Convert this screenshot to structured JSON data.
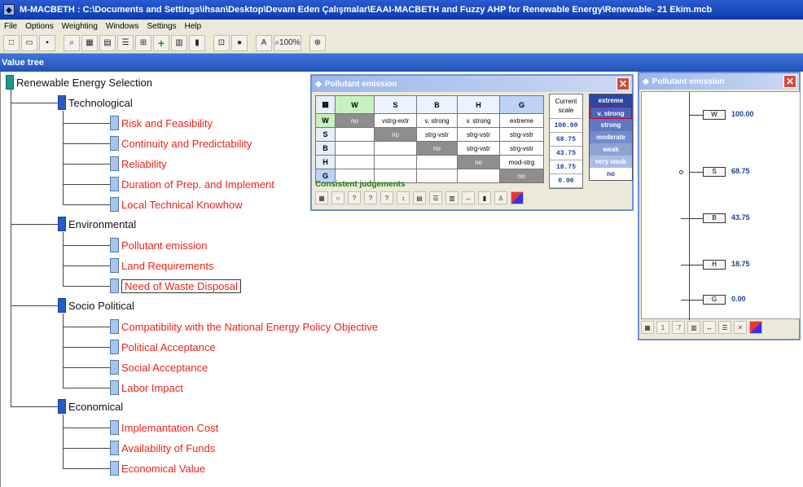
{
  "window": {
    "title": "M-MACBETH : C:\\Documents and Settings\\ihsan\\Desktop\\Devam Eden Çalışmalar\\EAAI-MACBETH and Fuzzy AHP for Renewable Energy\\Renewable- 21 Ekim.mcb"
  },
  "menu": [
    "File",
    "Options",
    "Weighting",
    "Windows",
    "Settings",
    "Help"
  ],
  "toolbar": {
    "zoom": "100%"
  },
  "panel": {
    "title": "Value tree"
  },
  "tree": {
    "root": "Renewable Energy Selection",
    "groups": [
      {
        "label": "Technological",
        "items": [
          "Risk and Feasibility",
          "Continuity and Predictability",
          "Reliability",
          "Duration of Prep. and Implement",
          "Local Technical Knowhow"
        ]
      },
      {
        "label": "Environmental",
        "items": [
          "Pollutant emission",
          "Land Requirements",
          "Need of Waste Disposal"
        ]
      },
      {
        "label": "Socio Political",
        "items": [
          "Compatibility with the National Energy Policy Objective",
          "Political Acceptance",
          "Social Acceptance",
          "Labor Impact"
        ]
      },
      {
        "label": "Economical",
        "items": [
          "Implemantation Cost",
          "Availability of Funds",
          "Economical Value"
        ]
      }
    ]
  },
  "matrix": {
    "title": "Pollutant emission",
    "columns": [
      "W",
      "S",
      "B",
      "H",
      "G"
    ],
    "rows": [
      {
        "h": "W",
        "cells": [
          "no",
          "vstrg-extr",
          "v. strong",
          "v. strong",
          "extreme"
        ]
      },
      {
        "h": "S",
        "cells": [
          "",
          "no",
          "strg-vstr",
          "strg-vstr",
          "strg-vstr"
        ]
      },
      {
        "h": "B",
        "cells": [
          "",
          "",
          "no",
          "strg-vstr",
          "strg-vstr"
        ]
      },
      {
        "h": "H",
        "cells": [
          "",
          "",
          "",
          "no",
          "mod-strg"
        ]
      },
      {
        "h": "G",
        "cells": [
          "",
          "",
          "",
          "",
          "no"
        ]
      }
    ],
    "scale_header": "Current scale",
    "scale": [
      "100.00",
      "68.75",
      "43.75",
      "18.75",
      "0.00"
    ],
    "judgements": [
      "extreme",
      "v. strong",
      "strong",
      "moderate",
      "weak",
      "very weak",
      "no"
    ],
    "consistency": "Consistent judgements"
  },
  "scale_window": {
    "title": "Pollutant emission",
    "items": [
      {
        "label": "W",
        "value": "100.00"
      },
      {
        "label": "S",
        "value": "68.75"
      },
      {
        "label": "B",
        "value": "43.75"
      },
      {
        "label": "H",
        "value": "18.75"
      },
      {
        "label": "G",
        "value": "0.00"
      }
    ]
  },
  "colors": {
    "tree_leaf_text": "#e8231c",
    "title_bar": "#0a3cb0",
    "consistent": "#1d7a12"
  }
}
